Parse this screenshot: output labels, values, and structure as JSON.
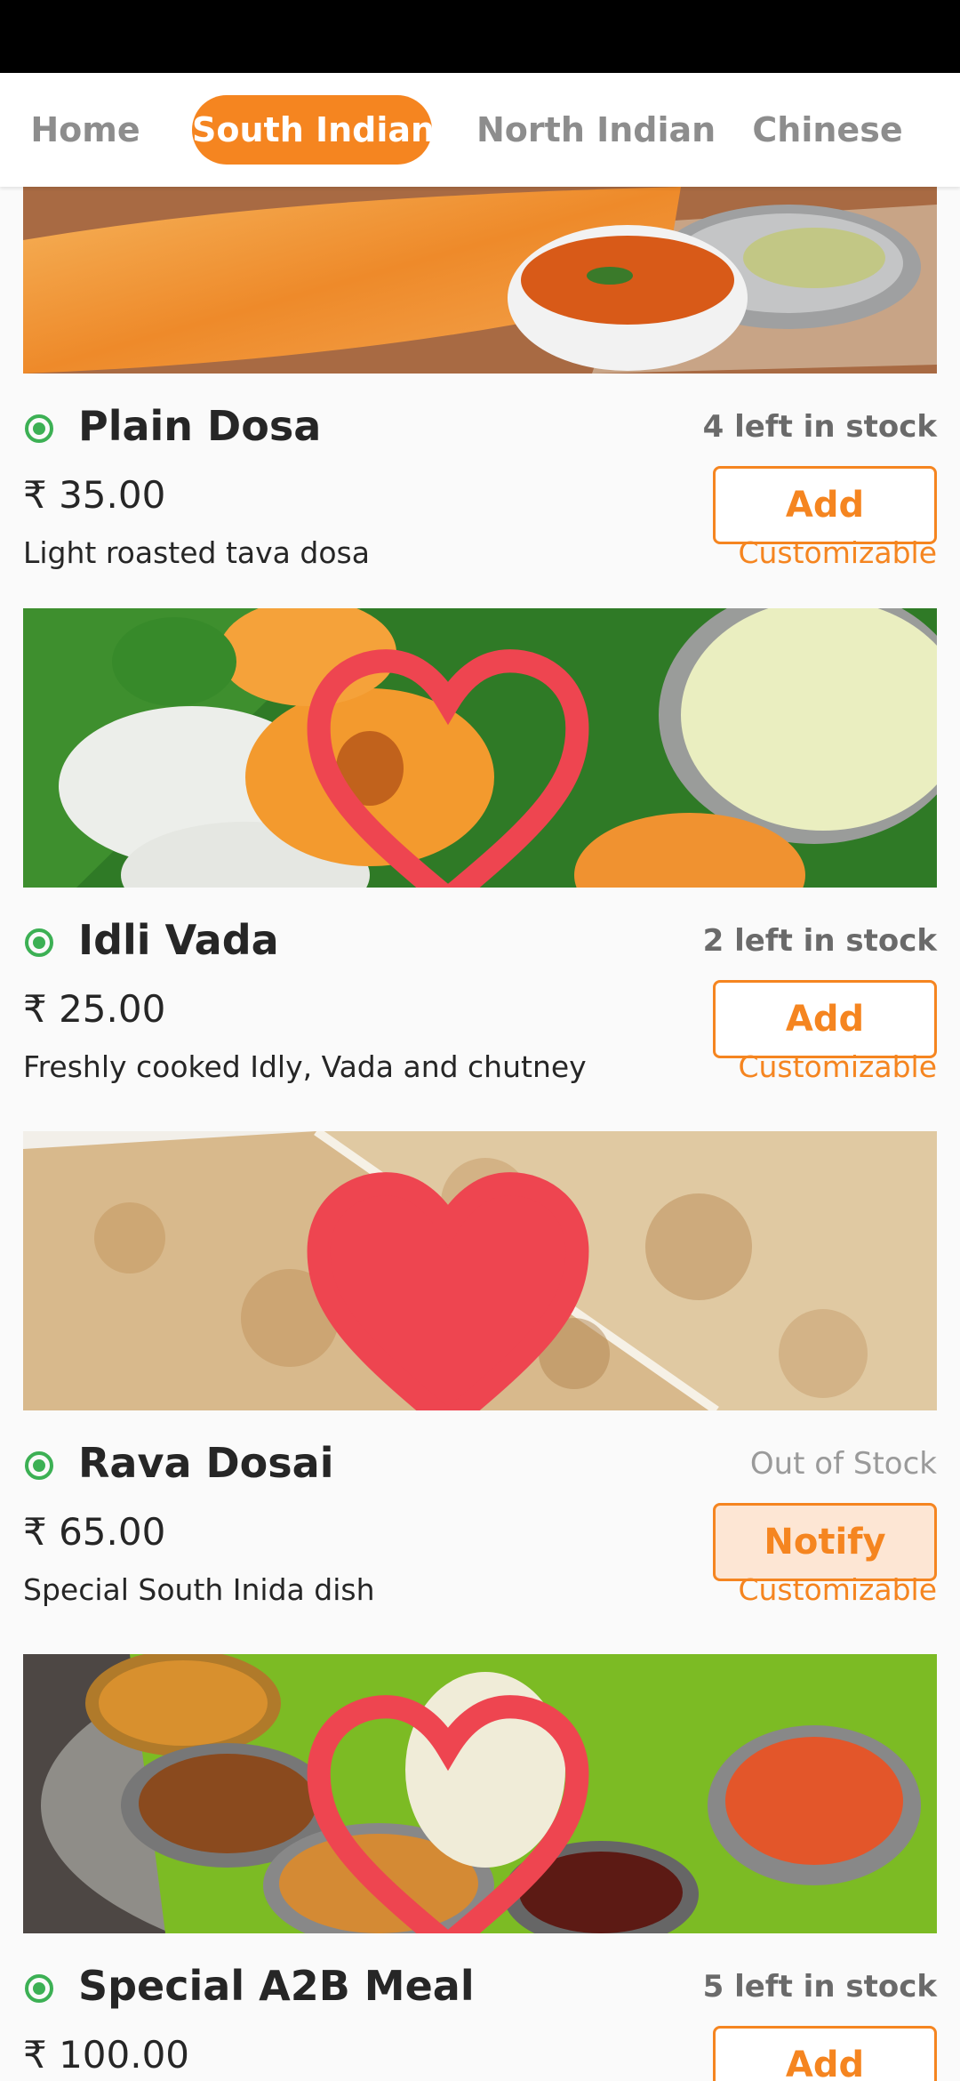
{
  "tabs": [
    {
      "label": "Home",
      "active": false
    },
    {
      "label": "South Indian",
      "active": true
    },
    {
      "label": "North Indian",
      "active": false
    },
    {
      "label": "Chinese",
      "active": false
    }
  ],
  "colors": {
    "accent": "#f58520",
    "veg": "#3cb054",
    "heart": "#ee4550",
    "status_bar": "#000000"
  },
  "items": [
    {
      "name": "Plain Dosa",
      "stock": "4 left in stock",
      "price": "₹ 35.00",
      "action": "Add",
      "description": "Light roasted tava dosa",
      "customizable": "Customizable",
      "favorite": "none",
      "image": "dosa-image"
    },
    {
      "name": "Idli Vada",
      "stock": "2 left in stock",
      "price": "₹ 25.00",
      "action": "Add",
      "description": "Freshly cooked Idly, Vada and chutney",
      "customizable": "Customizable",
      "favorite": "outline",
      "image": "idli-vada-image"
    },
    {
      "name": "Rava Dosai",
      "stock": "Out of Stock",
      "price": "₹ 65.00",
      "action": "Notify",
      "description": "Special South Inida dish",
      "customizable": "Customizable",
      "favorite": "filled",
      "image": "rava-dosai-image"
    },
    {
      "name": "Special A2B Meal",
      "stock": "5 left in stock",
      "price": "₹ 100.00",
      "action": "Add",
      "description": "",
      "customizable": "",
      "favorite": "outline",
      "image": "meal-image"
    }
  ]
}
